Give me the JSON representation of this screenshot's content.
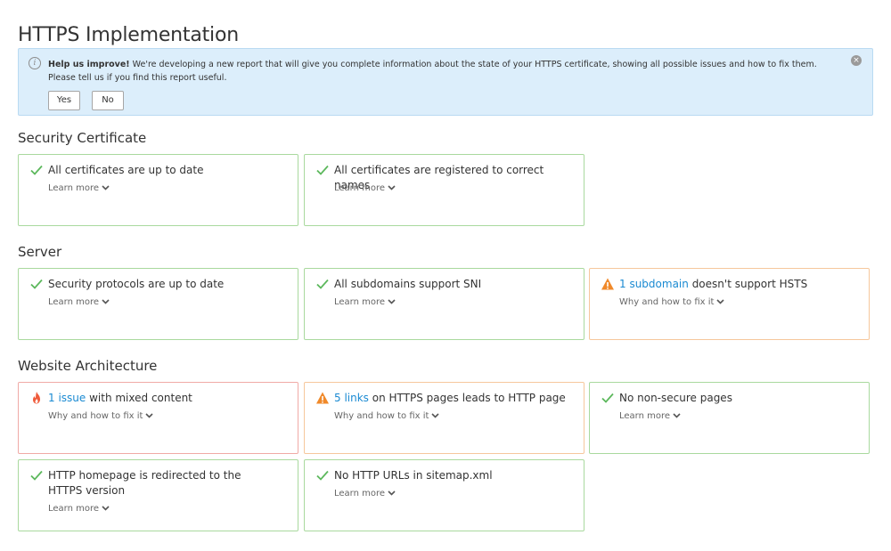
{
  "page_title": "HTTPS Implementation",
  "banner": {
    "bold": "Help us improve!",
    "line1": " We're developing a new report that will give you complete information about the state of your HTTPS certificate, showing all possible issues and how to fix them.",
    "line2": "Please tell us if you find this report useful.",
    "yes_label": "Yes",
    "no_label": "No",
    "info_icon": "i",
    "close_icon": "×"
  },
  "sections": {
    "security": {
      "heading": "Security Certificate",
      "card1": {
        "title": "All certificates are up to date",
        "more": "Learn more"
      },
      "card2": {
        "title": "All certificates are registered to correct names",
        "more": "Learn more"
      }
    },
    "server": {
      "heading": "Server",
      "card1": {
        "title": "Security protocols are up to date",
        "more": "Learn more"
      },
      "card2": {
        "title": "All subdomains support SNI",
        "more": "Learn more"
      },
      "card3": {
        "link": "1 subdomain",
        "rest": " doesn't support HSTS",
        "more": "Why and how to fix it"
      }
    },
    "architecture": {
      "heading": "Website Architecture",
      "card1": {
        "link": "1 issue",
        "rest": " with mixed content",
        "more": "Why and how to fix it"
      },
      "card2": {
        "link": "5 links",
        "rest": " on HTTPS pages leads to HTTP page",
        "more": "Why and how to fix it"
      },
      "card3": {
        "title": "No non-secure pages",
        "more": "Learn more"
      },
      "card4": {
        "title": "HTTP homepage is redirected to the HTTPS version",
        "more": "Learn more"
      },
      "card5": {
        "title": "No HTTP URLs in sitemap.xml",
        "more": "Learn more"
      }
    }
  },
  "colors": {
    "ok": "#5cb85c",
    "warn": "#f0892a",
    "error": "#ef5b3b",
    "link": "#1a8ad2",
    "banner_bg": "#dceefb"
  },
  "icons": {
    "ok": "check-icon",
    "warn": "warning-icon",
    "error": "fire-icon",
    "expand": "chevron-down-icon"
  }
}
